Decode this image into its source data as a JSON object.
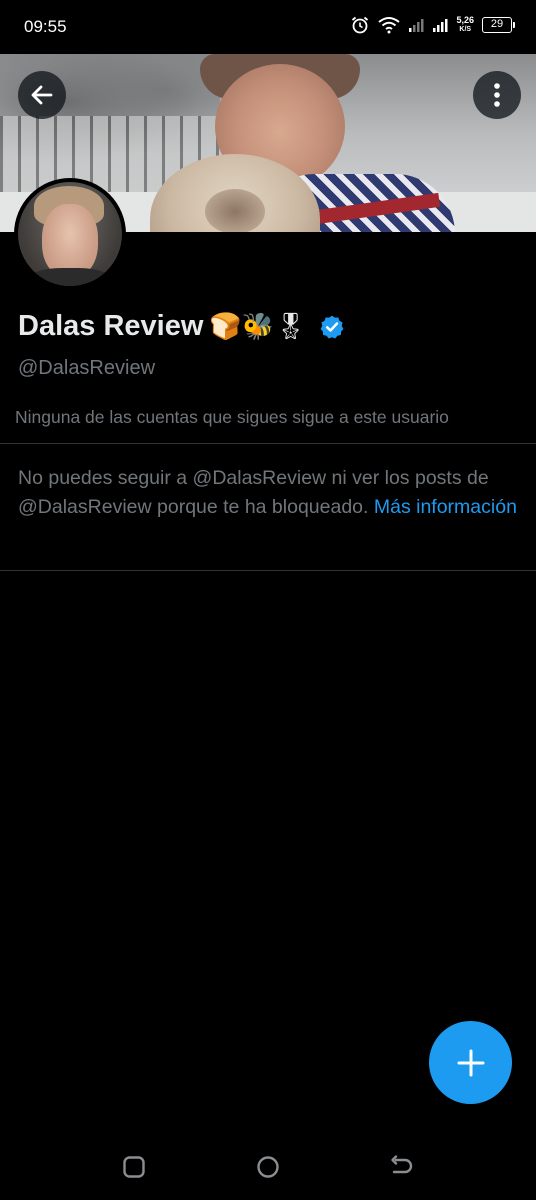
{
  "status_bar": {
    "time": "09:55",
    "net_speed_value": "5,26",
    "net_speed_unit": "K/S",
    "battery": "29"
  },
  "profile": {
    "display_name": "Dalas Review",
    "emojis": "🍞🐝🎖",
    "handle": "@DalasReview",
    "followers_note": "Ninguna de las cuentas que sigues sigue a este usuario",
    "blocked_message_prefix": "No puedes seguir a @DalasReview ni ver los posts de @DalasReview porque te ha bloqueado. ",
    "more_info_link": "Más información"
  },
  "colors": {
    "accent": "#1d9bf0",
    "background": "#000000",
    "secondary_text": "#71767b",
    "primary_text": "#e7e9ea"
  },
  "icons": {
    "back": "arrow-left-icon",
    "more": "more-vertical-icon",
    "verified": "verified-badge-icon",
    "compose": "plus-icon",
    "nav_recents": "square-icon",
    "nav_home": "circle-icon",
    "nav_back": "back-arrow-icon"
  }
}
